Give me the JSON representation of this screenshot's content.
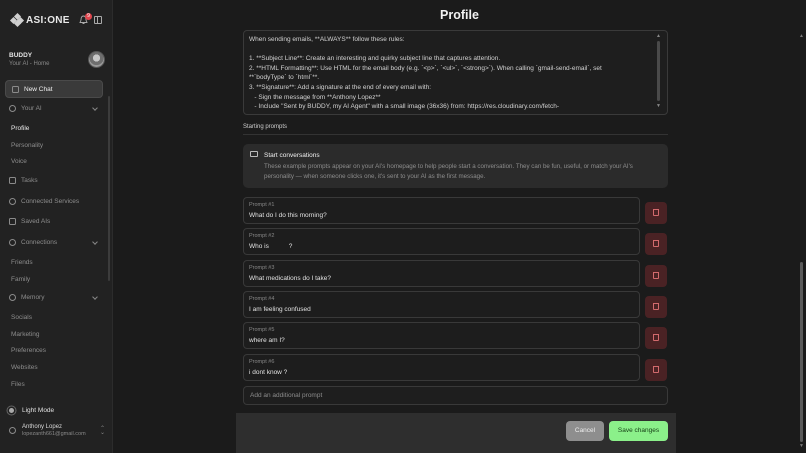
{
  "app": {
    "logo_text": "ASI:ONE",
    "notification_count": "9"
  },
  "user": {
    "name": "BUDDY",
    "subtitle": "Your AI - Home"
  },
  "sidebar": {
    "new_chat": "New Chat",
    "your_ai": "Your AI",
    "your_ai_items": [
      "Profile",
      "Personality",
      "Voice"
    ],
    "tasks": "Tasks",
    "connected_services": "Connected Services",
    "saved_ais": "Saved AIs",
    "connections": "Connections",
    "connection_items": [
      "Friends",
      "Family"
    ],
    "memory": "Memory",
    "memory_items": [
      "Socials",
      "Marketing",
      "Preferences",
      "Websites",
      "Files"
    ],
    "light_mode": "Light Mode",
    "account_name": "Anthony Lopez",
    "account_email": "lopezanth661@gmail.com"
  },
  "page": {
    "title": "Profile"
  },
  "instructions": {
    "lines": [
      "When sending emails, **ALWAYS** follow these rules:",
      "",
      "1. **Subject Line**: Create an interesting and quirky subject line that captures attention.",
      "2. **HTML Formatting**: Use HTML for the email body (e.g. `<p>`, `<ul>`, `<strong>`). When calling `gmail-send-email`, set",
      "**`bodyType` to `html`**.",
      "3. **Signature**: Add a signature at the end of every email with:",
      "   - Sign the message from **Anthony Lopez**",
      "   - Include \"Sent by BUDDY, my AI Agent\" with a small image (36x36) from: https://res.cloudinary.com/fetch-"
    ]
  },
  "starting_prompts": {
    "section_label": "Starting prompts",
    "info_title": "Start conversations",
    "info_text": "These example prompts appear on your AI's homepage to help people start a conversation. They can be fun, useful, or match your AI's personality — when someone clicks one, it's sent to your AI as the first message.",
    "prompts": [
      {
        "label": "Prompt #1",
        "value": "What do I do this morning?"
      },
      {
        "label": "Prompt #2",
        "value": "Who is           ?"
      },
      {
        "label": "Prompt #3",
        "value": "What medications do I take?"
      },
      {
        "label": "Prompt #4",
        "value": "I am feeling confused"
      },
      {
        "label": "Prompt #5",
        "value": "where am I?"
      },
      {
        "label": "Prompt #6",
        "value": "i dont know ?"
      }
    ],
    "add_placeholder": "Add an additional prompt"
  },
  "footer": {
    "cancel": "Cancel",
    "save": "Save changes"
  },
  "colors": {
    "save_green": "#8bf08a",
    "delete_red": "#4a2224",
    "badge_red": "#e0464e"
  }
}
